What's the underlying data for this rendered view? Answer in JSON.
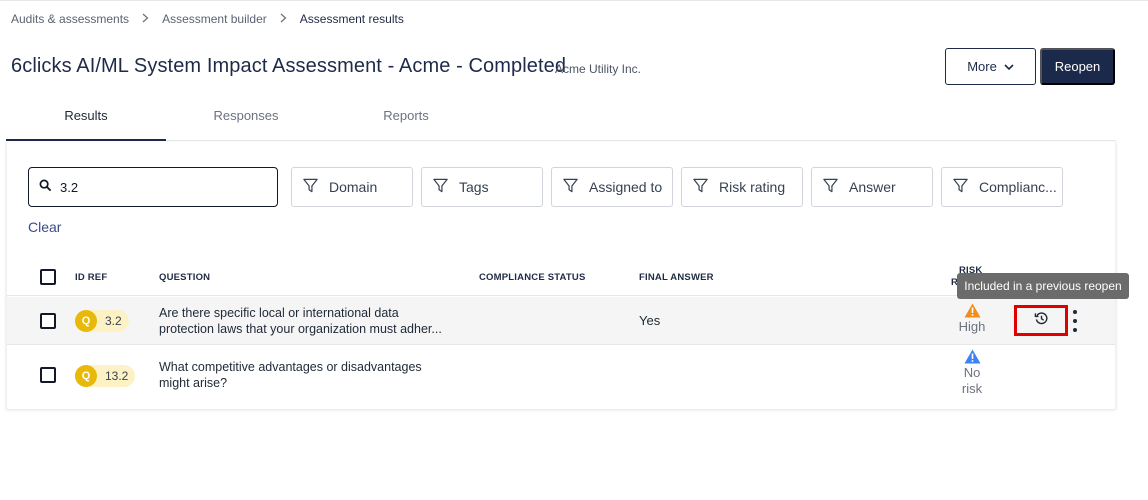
{
  "breadcrumb": {
    "items": [
      "Audits & assessments",
      "Assessment builder"
    ],
    "current": "Assessment results",
    "separator": ">"
  },
  "header": {
    "title": "6clicks AI/ML System Impact Assessment - Acme - Completed",
    "organization": "Acme Utility Inc.",
    "more_label": "More",
    "reopen_label": "Reopen"
  },
  "tabs": [
    {
      "label": "Results",
      "active": true
    },
    {
      "label": "Responses",
      "active": false
    },
    {
      "label": "Reports",
      "active": false
    }
  ],
  "search": {
    "value": "3.2"
  },
  "filters": [
    "Domain",
    "Tags",
    "Assigned to",
    "Risk rating",
    "Answer",
    "Complianc..."
  ],
  "clear_label": "Clear",
  "table": {
    "headers": {
      "id_ref": "ID REF",
      "question": "QUESTION",
      "compliance_status": "COMPLIANCE STATUS",
      "final_answer": "FINAL ANSWER",
      "risk_rating_line1": "RISK",
      "risk_rating_line2": "R"
    },
    "rows": [
      {
        "badge": "Q",
        "id": "3.2",
        "question_line1": "Are there specific local or international data",
        "question_line2": "protection laws that your organization must adher...",
        "compliance_status": "",
        "final_answer": "Yes",
        "risk": "High",
        "risk_color": "#f28c1a"
      },
      {
        "badge": "Q",
        "id": "13.2",
        "question_line1": "What competitive advantages or disadvantages",
        "question_line2": "might arise?",
        "compliance_status": "",
        "final_answer": "",
        "risk_line1": "No",
        "risk_line2": "risk",
        "risk_color": "#3b82f6"
      }
    ]
  },
  "tooltip": "Included in a previous reopen",
  "colors": {
    "primary": "#1b2a4a",
    "highlight_box": "#e00000",
    "badge_circle": "#e8b90b",
    "badge_bg": "#fdf1c6",
    "link": "#3b4b8a"
  },
  "icons": [
    "chevron-right-icon",
    "chevron-down-icon",
    "search-icon",
    "filter-icon",
    "warning-icon",
    "history-icon",
    "kebab-menu-icon"
  ]
}
